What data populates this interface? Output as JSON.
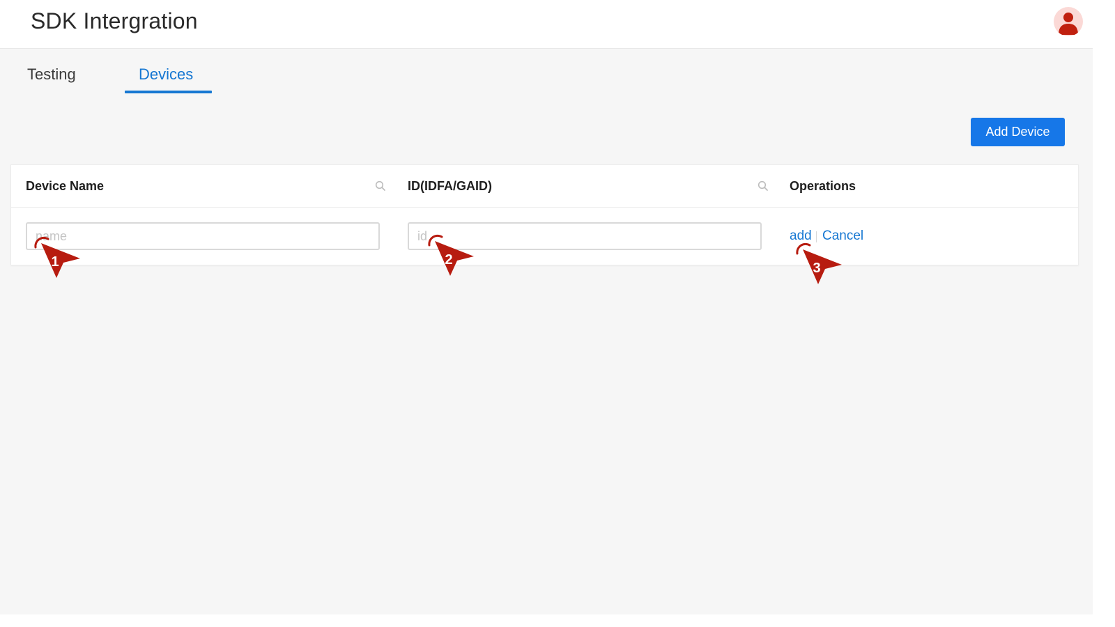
{
  "header": {
    "title": "SDK Intergration",
    "avatar_icon": "user-avatar-icon"
  },
  "tabs": [
    {
      "label": "Testing",
      "active": false
    },
    {
      "label": "Devices",
      "active": true
    }
  ],
  "toolbar": {
    "add_device_label": "Add Device"
  },
  "table": {
    "columns": [
      {
        "label": "Device Name",
        "searchable": true
      },
      {
        "label": "ID(IDFA/GAID)",
        "searchable": true
      },
      {
        "label": "Operations",
        "searchable": false
      }
    ],
    "edit_row": {
      "name_value": "",
      "name_placeholder": "name",
      "id_value": "",
      "id_placeholder": "id",
      "add_label": "add",
      "cancel_label": "Cancel"
    }
  },
  "annotations": [
    {
      "number": "1",
      "target": "name-input"
    },
    {
      "number": "2",
      "target": "id-input"
    },
    {
      "number": "3",
      "target": "add-link"
    }
  ],
  "colors": {
    "accent": "#1677d2",
    "button": "#1677e8",
    "marker": "#b71c10",
    "avatar_bg": "#fbd9d6"
  }
}
